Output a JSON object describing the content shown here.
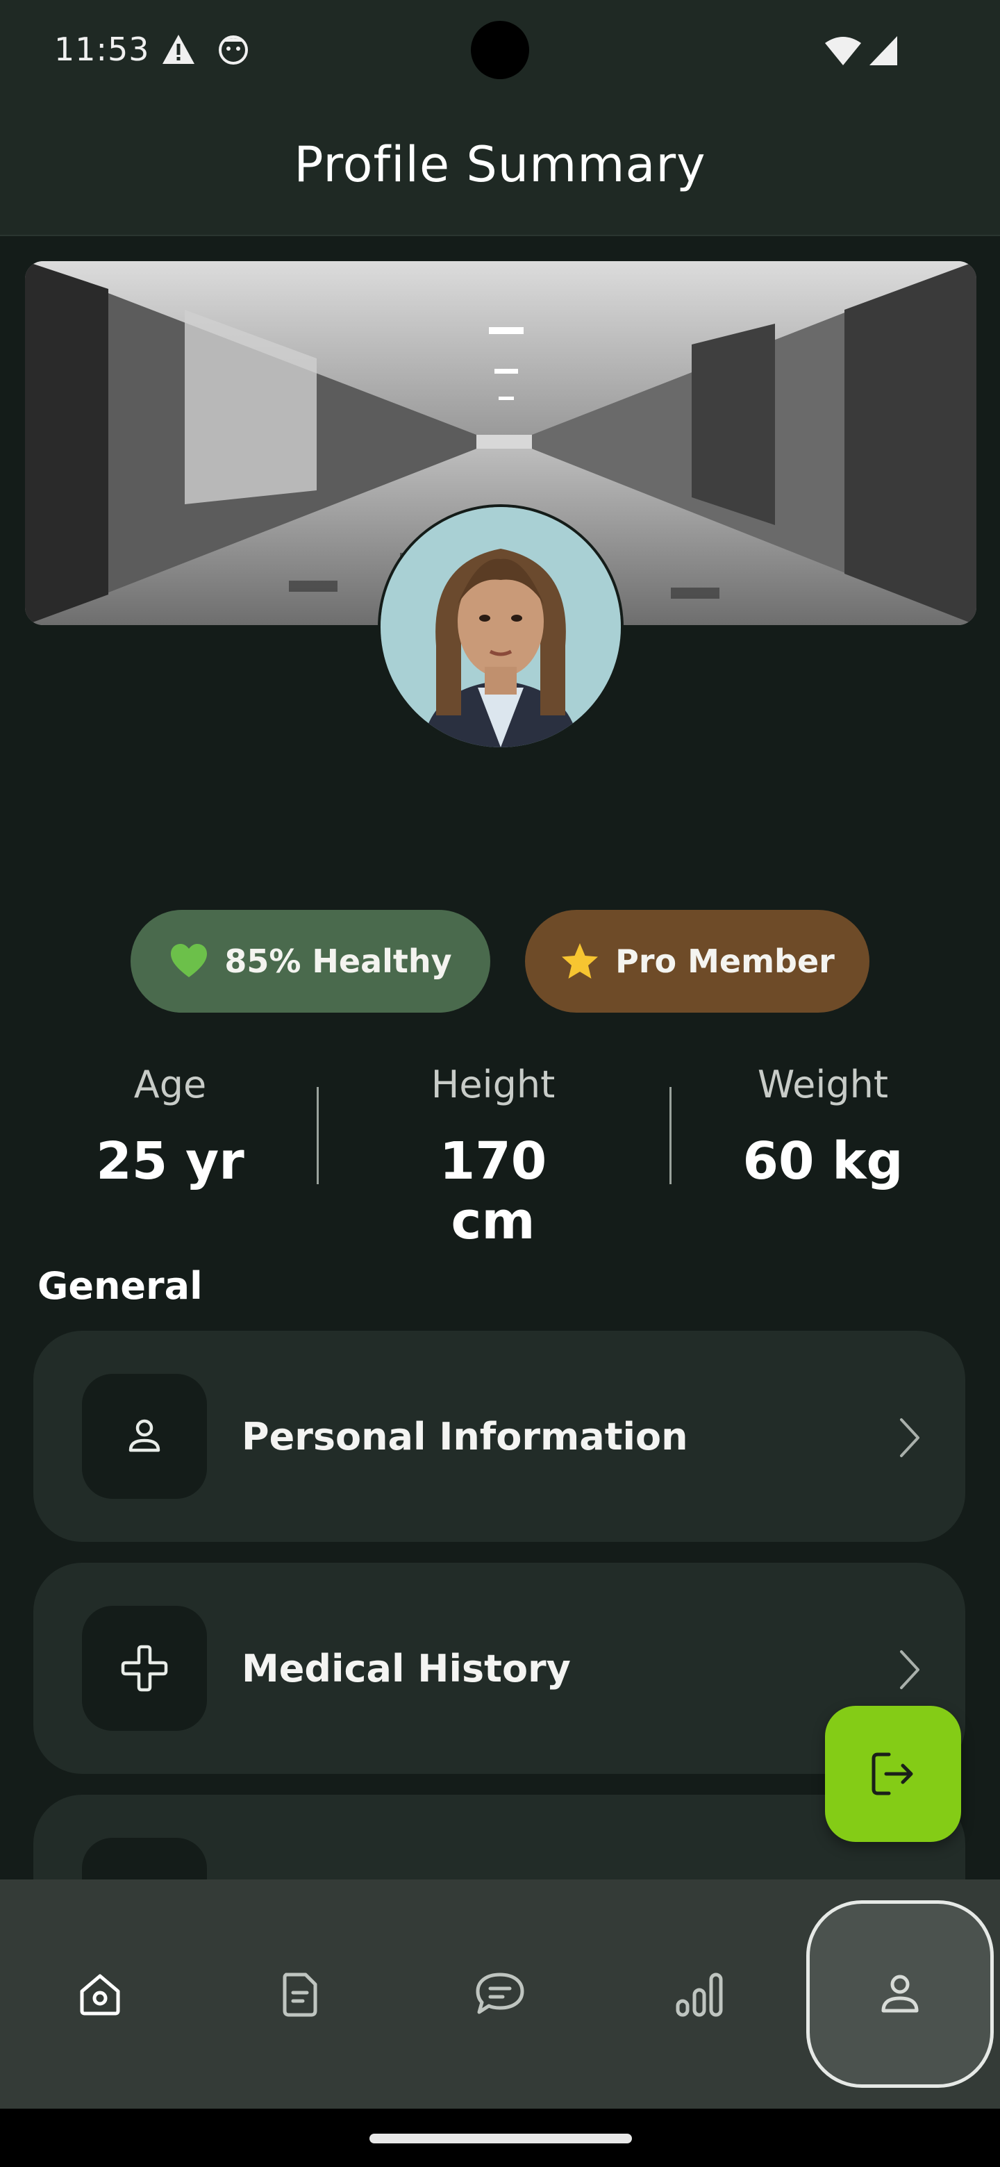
{
  "status_bar": {
    "time": "11:53"
  },
  "header": {
    "title": "Profile Summary"
  },
  "profile": {
    "cover_alt": "hospital-corridor-photo",
    "avatar_alt": "profile-photo"
  },
  "badges": [
    {
      "label": "85% Healthy",
      "icon": "green-heart-icon",
      "color": "#4a6a4d"
    },
    {
      "label": "Pro Member",
      "icon": "star-icon",
      "color": "#6e4b28"
    }
  ],
  "stats": [
    {
      "label": "Age",
      "value": "25 yr"
    },
    {
      "label": "Height",
      "value": "170 cm"
    },
    {
      "label": "Weight",
      "value": "60 kg"
    }
  ],
  "general": {
    "title": "General",
    "items": [
      {
        "label": "Personal Information",
        "icon": "person-icon"
      },
      {
        "label": "Medical History",
        "icon": "medical-cross-icon"
      },
      {
        "label": "",
        "icon": ""
      }
    ]
  },
  "fab": {
    "icon": "logout-icon",
    "color": "#84cc16"
  },
  "bottom_nav": {
    "items": [
      {
        "icon": "home-icon",
        "active": false
      },
      {
        "icon": "document-icon",
        "active": false
      },
      {
        "icon": "chat-icon",
        "active": false
      },
      {
        "icon": "stats-icon",
        "active": false
      },
      {
        "icon": "profile-icon",
        "active": true
      }
    ]
  }
}
